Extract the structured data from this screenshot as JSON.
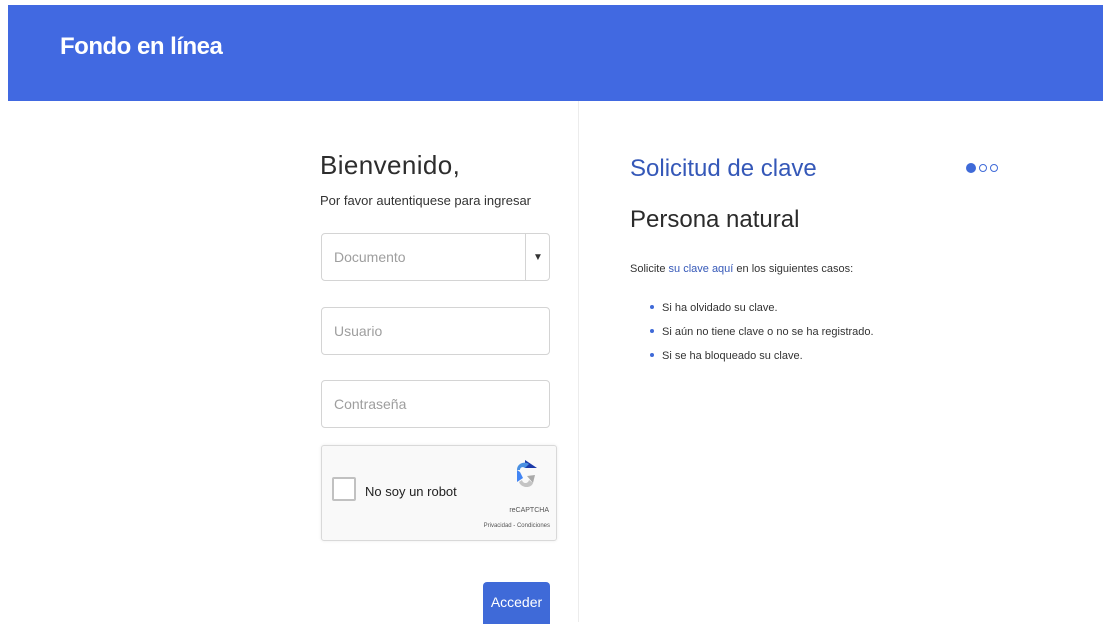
{
  "header": {
    "title": "Fondo en línea",
    "background": "#4169e1"
  },
  "login": {
    "title": "Bienvenido,",
    "subtitle": "Por favor autentiquese para ingresar",
    "document_select": {
      "value": "Documento",
      "arrow_icon": "caret-down-icon"
    },
    "user_field": {
      "placeholder": "Usuario",
      "value": ""
    },
    "password_field": {
      "placeholder": "Contraseña",
      "value": ""
    },
    "captcha": {
      "label": "No soy un robot",
      "brand": "reCAPTCHA",
      "links": "Privacidad - Condiciones",
      "icon": "recaptcha-icon"
    },
    "submit_label": "Acceder"
  },
  "info": {
    "title": "Solicitud de clave",
    "subtitle": "Persona natural",
    "intro_prefix": "Solicite ",
    "intro_link": "su clave aquí",
    "intro_suffix": " en los siguientes casos:",
    "items": [
      "Si ha olvidado su clave.",
      "Si aún no tiene clave o no se ha registrado.",
      "Si se ha bloqueado su clave."
    ]
  },
  "carousel": {
    "dots": 3,
    "active_index": 0
  },
  "colors": {
    "accent": "#3f6ad8",
    "link": "#3558b8"
  }
}
